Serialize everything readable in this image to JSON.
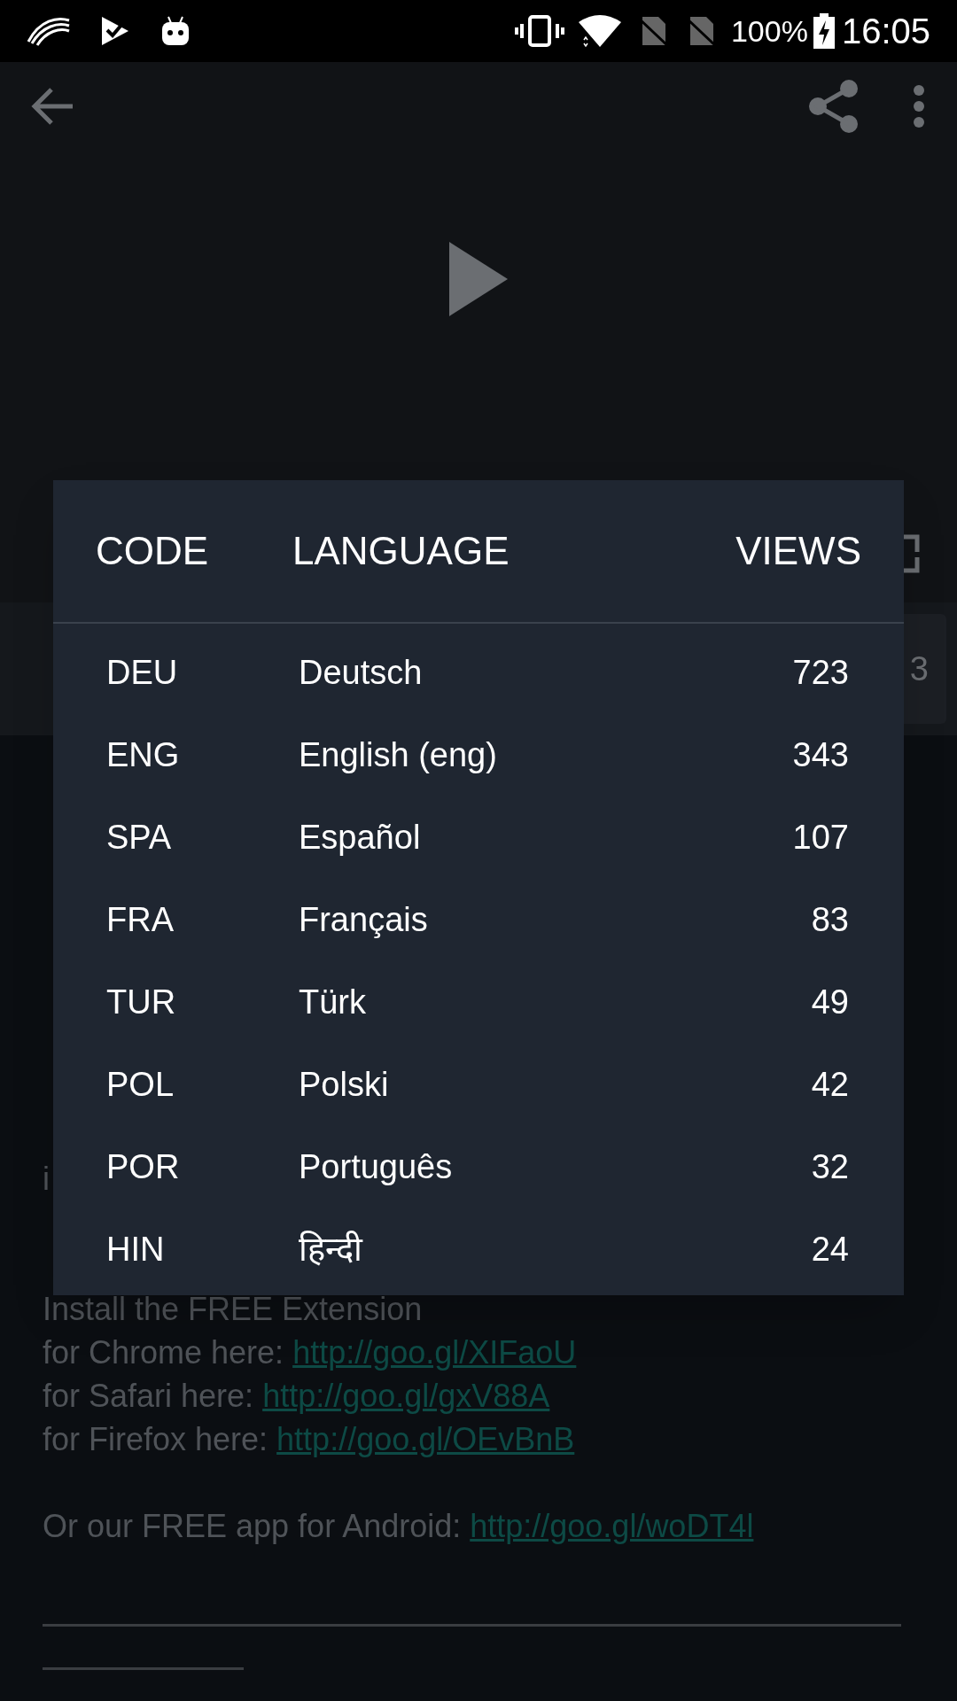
{
  "status_bar": {
    "battery": "100%",
    "time": "16:05"
  },
  "stats_fragment": "3",
  "description": {
    "paragraphs": [
      [
        {
          "text": "i"
        }
      ],
      [
        {
          "text": "Install the FREE Extension"
        },
        {
          "text": "for Chrome here: ",
          "link": "http://goo.gl/XIFaoU"
        },
        {
          "text": "for Safari here: ",
          "link": "http://goo.gl/gxV88A"
        },
        {
          "text": "for Firefox here: ",
          "link": "http://goo.gl/OEvBnB"
        }
      ],
      [
        {
          "text": "Or our FREE app for Android: ",
          "link": "http://goo.gl/woDT4l"
        }
      ]
    ]
  },
  "dialog": {
    "columns": [
      "CODE",
      "LANGUAGE",
      "VIEWS"
    ],
    "rows": [
      {
        "code": "DEU",
        "language": "Deutsch",
        "views": "723"
      },
      {
        "code": "ENG",
        "language": "English (eng)",
        "views": "343"
      },
      {
        "code": "SPA",
        "language": "Español",
        "views": "107"
      },
      {
        "code": "FRA",
        "language": "Français",
        "views": "83"
      },
      {
        "code": "TUR",
        "language": "Türk",
        "views": "49"
      },
      {
        "code": "POL",
        "language": "Polski",
        "views": "42"
      },
      {
        "code": "POR",
        "language": "Português",
        "views": "32"
      },
      {
        "code": "HIN",
        "language": "हिन्दी",
        "views": "24"
      }
    ]
  }
}
